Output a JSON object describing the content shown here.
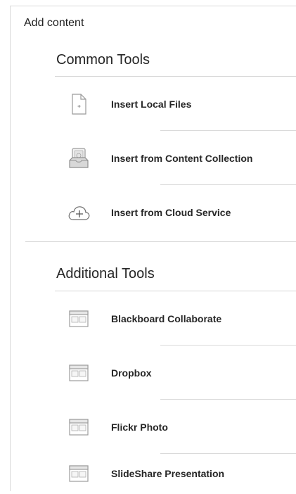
{
  "header": {
    "title": "Add content"
  },
  "common_tools": {
    "title": "Common Tools",
    "items": [
      {
        "label": "Insert Local Files",
        "icon": "file-icon"
      },
      {
        "label": "Insert from Content Collection",
        "icon": "content-collection-icon"
      },
      {
        "label": "Insert from Cloud Service",
        "icon": "cloud-plus-icon"
      }
    ]
  },
  "additional_tools": {
    "title": "Additional Tools",
    "items": [
      {
        "label": "Blackboard Collaborate",
        "icon": "window-tool-icon"
      },
      {
        "label": "Dropbox",
        "icon": "window-tool-icon"
      },
      {
        "label": "Flickr Photo",
        "icon": "window-tool-icon"
      },
      {
        "label": "SlideShare Presentation",
        "icon": "window-tool-icon"
      }
    ]
  }
}
